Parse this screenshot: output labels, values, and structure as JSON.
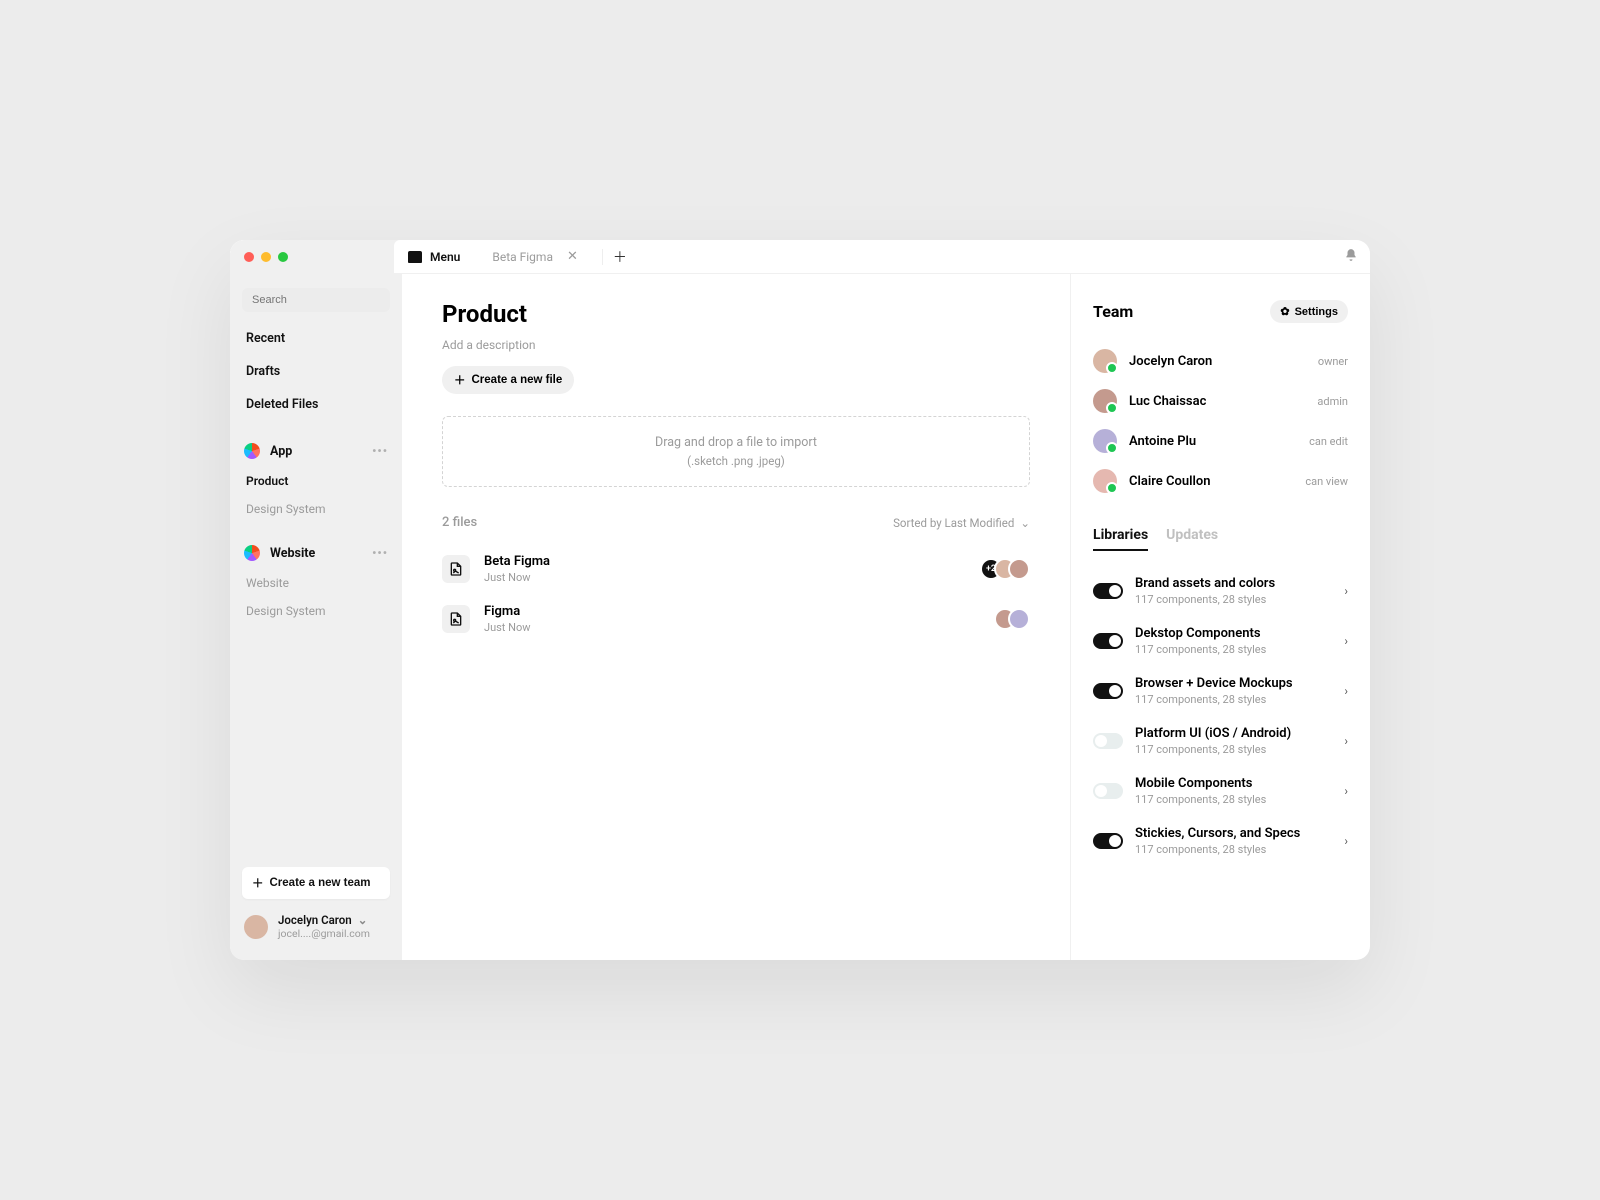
{
  "titlebar": {
    "menu_label": "Menu",
    "doc_tab_label": "Beta Figma"
  },
  "sidebar": {
    "search_placeholder": "Search",
    "nav": [
      "Recent",
      "Drafts",
      "Deleted Files"
    ],
    "sections": [
      {
        "title": "App",
        "items": [
          {
            "label": "Product",
            "active": true
          },
          {
            "label": "Design System",
            "active": false
          }
        ]
      },
      {
        "title": "Website",
        "items": [
          {
            "label": "Website",
            "active": false
          },
          {
            "label": "Design System",
            "active": false
          }
        ]
      }
    ],
    "new_team_label": "Create a new team",
    "user": {
      "name": "Jocelyn Caron",
      "email": "jocel....@gmail.com"
    }
  },
  "content": {
    "title": "Product",
    "description_placeholder": "Add a description",
    "create_file_label": "Create a new file",
    "dropzone_line1": "Drag and drop a file to import",
    "dropzone_line2": "(.sketch .png .jpeg)",
    "files_count": "2 files",
    "sort_label": "Sorted by Last Modified",
    "files": [
      {
        "name": "Beta Figma",
        "time": "Just Now",
        "extra_count": "+2",
        "avatars": 2
      },
      {
        "name": "Figma",
        "time": "Just Now",
        "extra_count": null,
        "avatars": 2
      }
    ]
  },
  "team": {
    "heading": "Team",
    "settings_label": "Settings",
    "members": [
      {
        "name": "Jocelyn Caron",
        "role": "owner"
      },
      {
        "name": "Luc Chaissac",
        "role": "admin"
      },
      {
        "name": "Antoine Plu",
        "role": "can edit"
      },
      {
        "name": "Claire Coullon",
        "role": "can view"
      }
    ]
  },
  "right_tabs": {
    "libraries": "Libraries",
    "updates": "Updates"
  },
  "libraries": [
    {
      "name": "Brand assets and colors",
      "info": "117 components, 28 styles",
      "on": true
    },
    {
      "name": "Dekstop Components",
      "info": "117 components, 28 styles",
      "on": true
    },
    {
      "name": "Browser + Device Mockups",
      "info": "117 components, 28 styles",
      "on": true
    },
    {
      "name": "Platform UI (iOS / Android)",
      "info": "117 components, 28 styles",
      "on": false
    },
    {
      "name": "Mobile Components",
      "info": "117 components, 28 styles",
      "on": false
    },
    {
      "name": "Stickies, Cursors, and Specs",
      "info": "117 components, 28 styles",
      "on": true
    }
  ],
  "avatar_colors": [
    "#d9b6a3",
    "#c49a8e",
    "#b6b0d8",
    "#e5b8b0"
  ]
}
